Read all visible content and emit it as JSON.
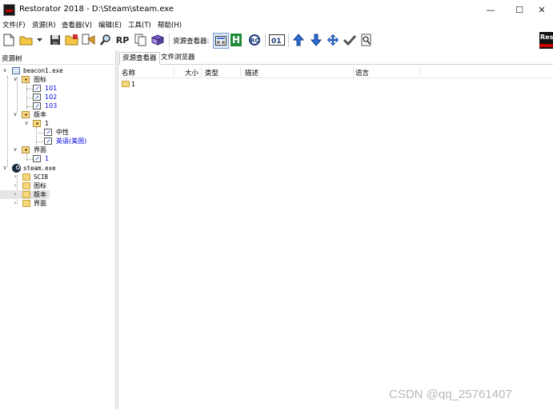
{
  "window": {
    "title": "Restorator 2018 - D:\\Steam\\steam.exe",
    "controls": {
      "minimize": "—",
      "maximize": "☐",
      "close": "✕"
    }
  },
  "menu": [
    "文件(F)",
    "资源(R)",
    "查看器(V)",
    "编辑(E)",
    "工具(T)",
    "帮助(H)"
  ],
  "toolbar": {
    "viewer_label": "资源查看器:",
    "logo_text": "Res",
    "icons": [
      "new-file-icon",
      "open-folder-icon",
      "dropdown-arrow-icon",
      "save-icon",
      "open-icon",
      "resource-tree-icon",
      "search-icon",
      "rp-icon",
      "copy-icon",
      "book-icon",
      "viewer-grid-icon",
      "hex-icon",
      "rc-icon",
      "binary-icon",
      "arrow-up-icon",
      "arrow-down-icon",
      "arrow-move-icon",
      "check-icon",
      "find-page-icon"
    ],
    "rp_label": "RP",
    "hex_label": "H",
    "rc_label": "RC",
    "bin_label": "01"
  },
  "left_panel": {
    "header": "资源树",
    "tree": {
      "beacon": {
        "name": "beacon1.exe",
        "icon_folder": "图标",
        "icons": [
          "101",
          "102",
          "103"
        ],
        "version": "版本",
        "version_id": "1",
        "neutral": "中性",
        "english": "英语(美国)",
        "ui": "界面",
        "ui_id": "1"
      },
      "steam": {
        "name": "steam.exe",
        "children": [
          "SCIB",
          "图标",
          "版本",
          "界面"
        ]
      }
    }
  },
  "right_panel": {
    "tabs": [
      "资源查看器",
      "文件浏览器"
    ],
    "columns": [
      "名称",
      "大小",
      "类型",
      "描述",
      "语言"
    ],
    "rows": [
      {
        "name": "1"
      }
    ]
  },
  "watermark": "CSDN @qq_25761407"
}
